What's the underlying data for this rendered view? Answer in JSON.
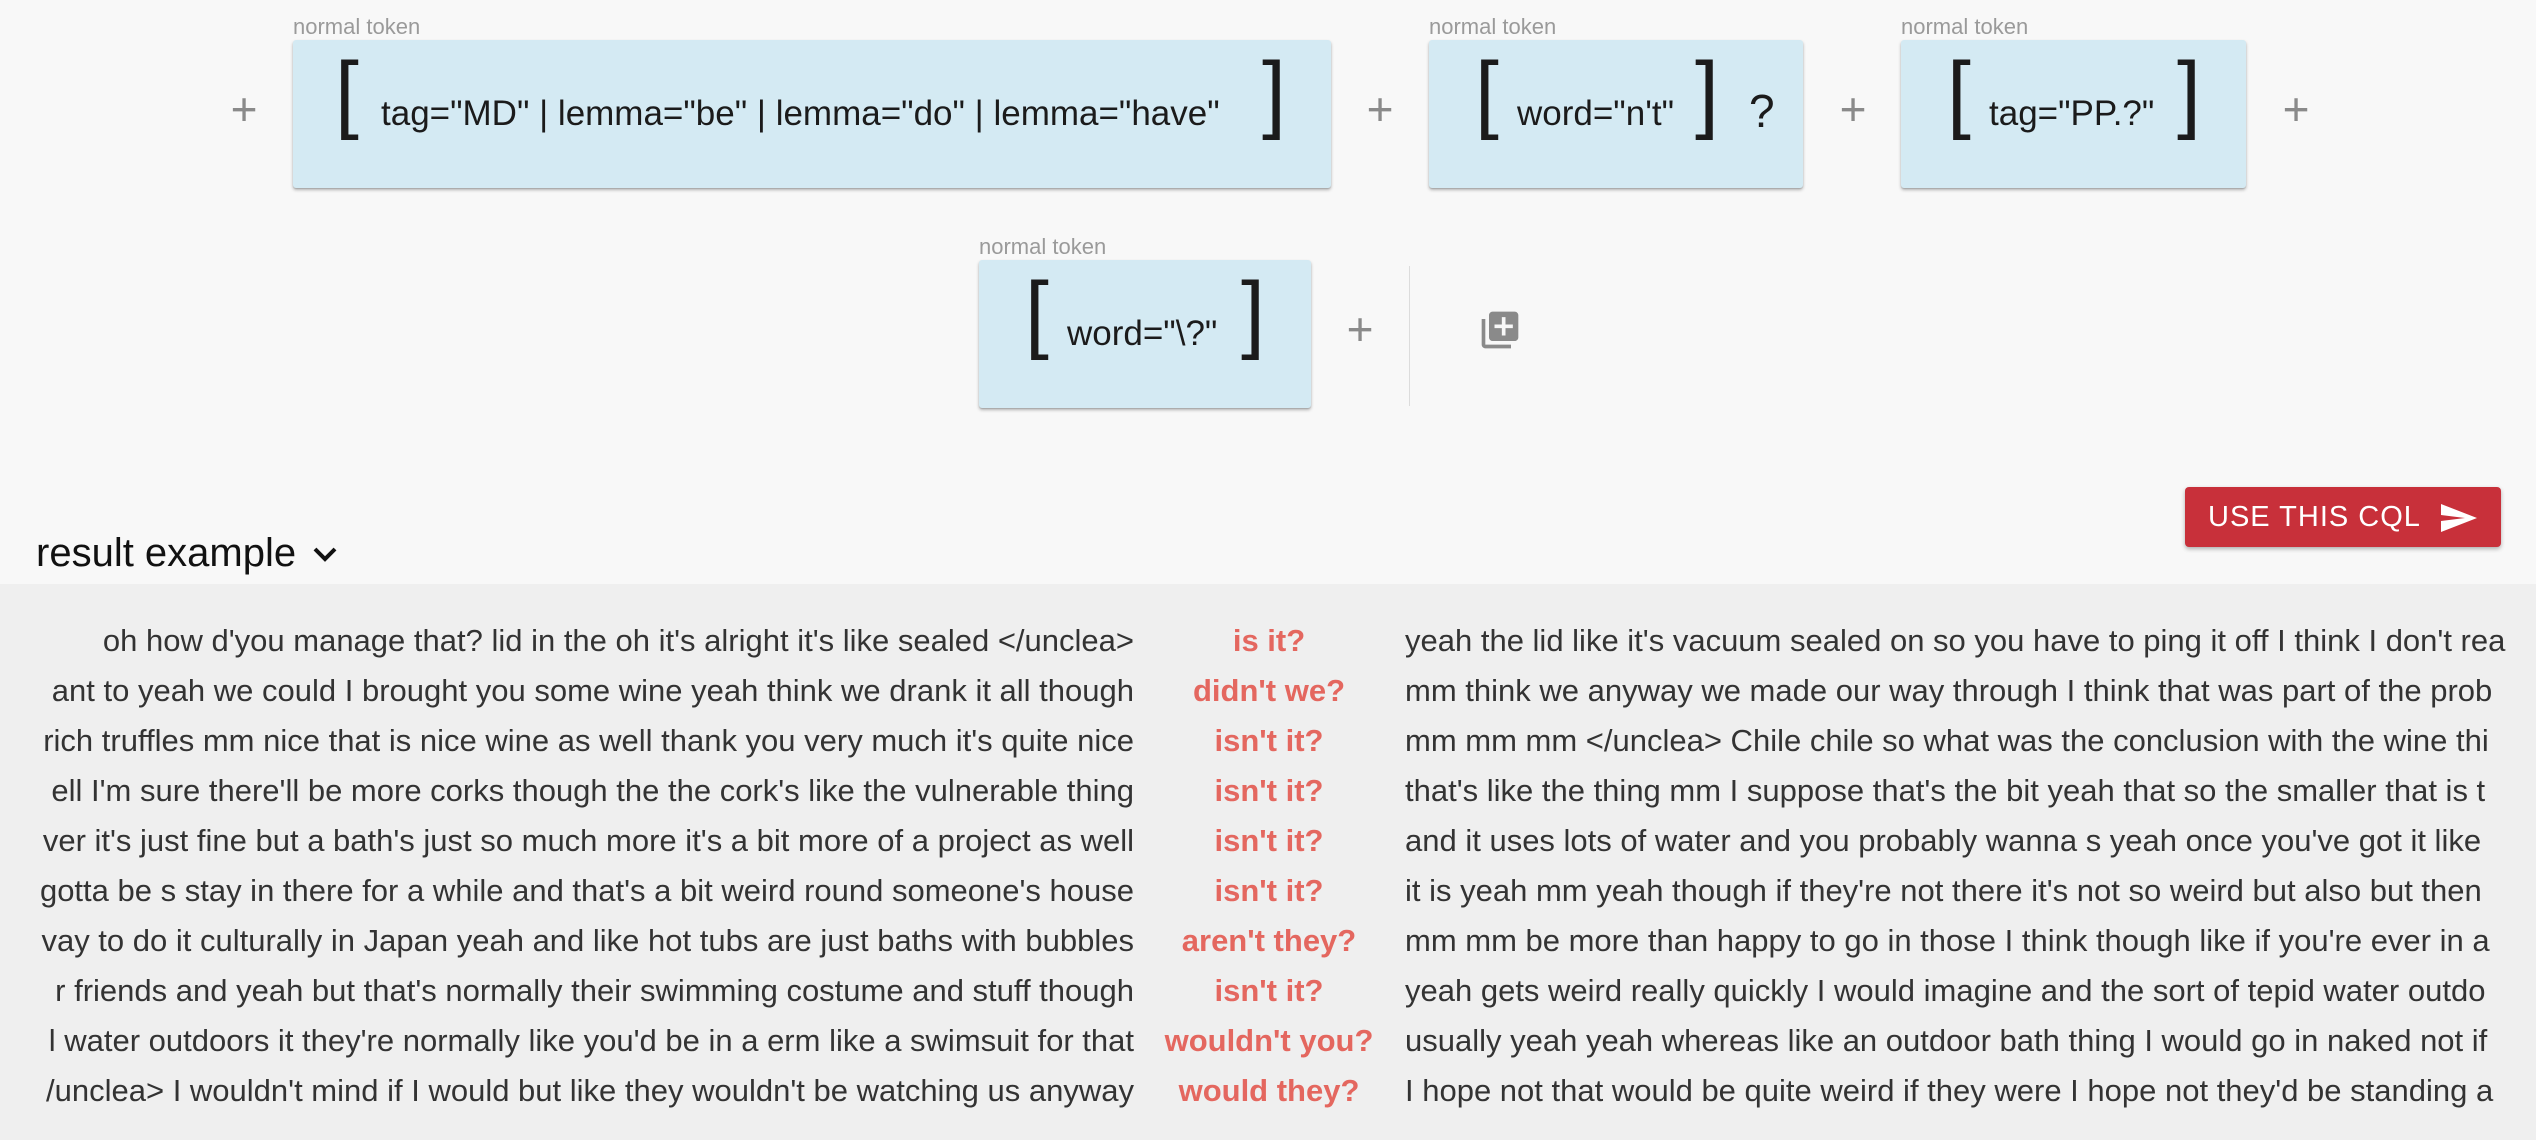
{
  "query_builder": {
    "row1": {
      "tokens": [
        {
          "label": "normal token",
          "text": "tag=\"MD\" | lemma=\"be\" | lemma=\"do\" | lemma=\"have\"",
          "quantifier": ""
        },
        {
          "label": "normal token",
          "text": "word=\"n't\"",
          "quantifier": "?"
        },
        {
          "label": "normal token",
          "text": "tag=\"PP.?\"",
          "quantifier": ""
        }
      ]
    },
    "row2": {
      "tokens": [
        {
          "label": "normal token",
          "text": "word=\"\\?\"",
          "quantifier": ""
        }
      ]
    },
    "plus_symbol": "+",
    "add_group_icon": "library-add-icon"
  },
  "actions": {
    "use_cql_label": "USE THIS CQL",
    "use_cql_icon": "send-icon",
    "accent_color": "#c8303a"
  },
  "result_example": {
    "title": "result example",
    "toggle_icon": "chevron-down-icon",
    "match_color": "#e4675f",
    "rows": [
      {
        "left": "oh how d'you manage that? lid in the oh it's alright it's like sealed </unclea>",
        "match": "is it?",
        "right": "yeah the lid like it's vacuum sealed on so you have to ping it off I think I don't rea"
      },
      {
        "left": "ant to yeah we could I brought you some wine yeah think we drank it all though",
        "match": "didn't we?",
        "right": "mm think we anyway we made our way through I think that was part of the prob"
      },
      {
        "left": "rich truffles mm nice that is nice wine as well thank you very much it's quite nice",
        "match": "isn't it?",
        "right": "mm mm mm </unclea> Chile chile so what was the conclusion with the wine thi"
      },
      {
        "left": "ell I'm sure there'll be more corks though the the cork's like the vulnerable thing",
        "match": "isn't it?",
        "right": "that's like the thing mm I suppose that's the bit yeah that so the smaller that is t"
      },
      {
        "left": "ver it's just fine but a bath's just so much more it's a bit more of a project as well",
        "match": "isn't it?",
        "right": "and it uses lots of water and you probably wanna s yeah once you've got it like"
      },
      {
        "left": "gotta be s stay in there for a while and that's a bit weird round someone's house",
        "match": "isn't it?",
        "right": "it is yeah mm yeah though if they're not there it's not so weird but also but then"
      },
      {
        "left": "vay to do it culturally in Japan yeah and like hot tubs are just baths with bubbles",
        "match": "aren't they?",
        "right": "mm mm be more than happy to go in those I think though like if you're ever in a"
      },
      {
        "left": "r friends and yeah but that's normally their swimming costume and stuff though",
        "match": "isn't it?",
        "right": "yeah gets weird really quickly I would imagine and the sort of tepid water outdo"
      },
      {
        "left": "l water outdoors it they're normally like you'd be in a erm like a swimsuit for that",
        "match": "wouldn't you?",
        "right": "usually yeah yeah whereas like an outdoor bath thing I would go in naked not if"
      },
      {
        "left": "/unclea> I wouldn't mind if I would but like they wouldn't be watching us anyway",
        "match": "would they?",
        "right": "I hope not that would be quite weird if they were I hope not they'd be standing a"
      }
    ]
  }
}
